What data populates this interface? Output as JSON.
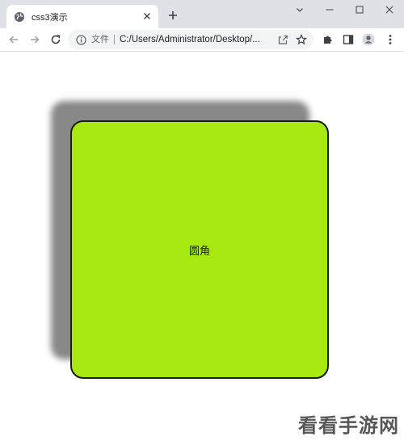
{
  "tab": {
    "title": "css3演示",
    "favicon_icon": "globe-icon",
    "close_icon": "close-icon"
  },
  "new_tab_icon": "plus-icon",
  "window_controls": [
    "chevron-down-icon",
    "minimize-icon",
    "maximize-icon",
    "close-icon"
  ],
  "toolbar": {
    "back_icon": "back-arrow-icon",
    "forward_icon": "forward-arrow-icon",
    "reload_icon": "reload-icon",
    "extensions_icon": "puzzle-icon",
    "sidepanel_icon": "side-panel-icon",
    "profile_icon": "profile-icon",
    "menu_icon": "kebab-menu-icon"
  },
  "omnibox": {
    "chip": "文件",
    "url": "C:/Users/Administrator/Desktop/...",
    "info_icon": "info-icon",
    "share_icon": "share-icon",
    "star_icon": "star-icon"
  },
  "demo": {
    "label": "圆角",
    "fill_color": "#a8e811",
    "shadow_color": "#888888"
  },
  "watermark": "看看手游网"
}
